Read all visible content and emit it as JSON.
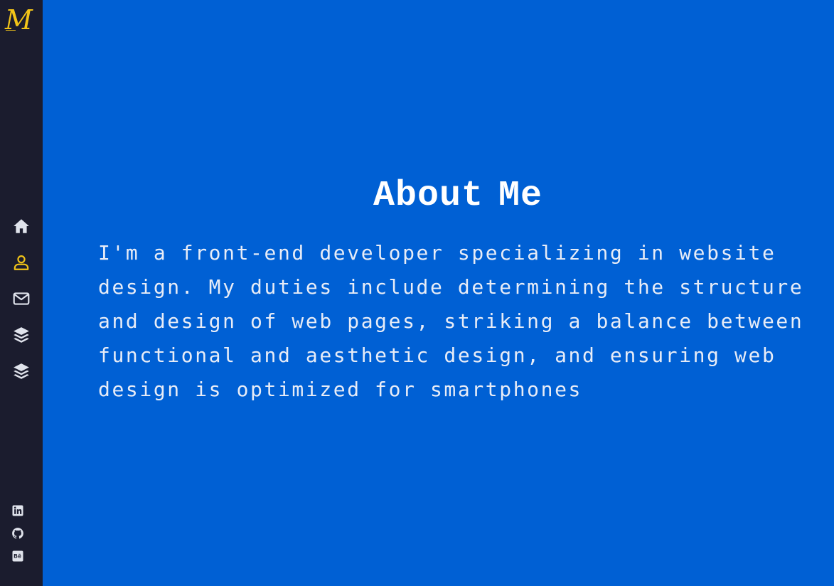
{
  "brand": {
    "logo_text": "M",
    "logo_color": "#F2C418"
  },
  "colors": {
    "background": "#0060D4",
    "sidebar": "#1B1C2E",
    "icon_default": "#E0E3EC",
    "icon_active": "#F2C418"
  },
  "sidebar": {
    "nav": [
      {
        "icon": "home-icon",
        "active": false
      },
      {
        "icon": "user-icon",
        "active": true
      },
      {
        "icon": "mail-icon",
        "active": false
      },
      {
        "icon": "layers-icon",
        "active": false
      },
      {
        "icon": "layers-icon",
        "active": false
      }
    ],
    "social": [
      {
        "icon": "linkedin-icon"
      },
      {
        "icon": "github-icon"
      },
      {
        "icon": "behance-icon"
      }
    ]
  },
  "about": {
    "title": "About Me",
    "text": "I'm a front-end developer specializing in website design. My duties include determining the structure and design of web pages, striking a balance between functional and aesthetic design, and ensuring web design is optimized for smartphones"
  }
}
